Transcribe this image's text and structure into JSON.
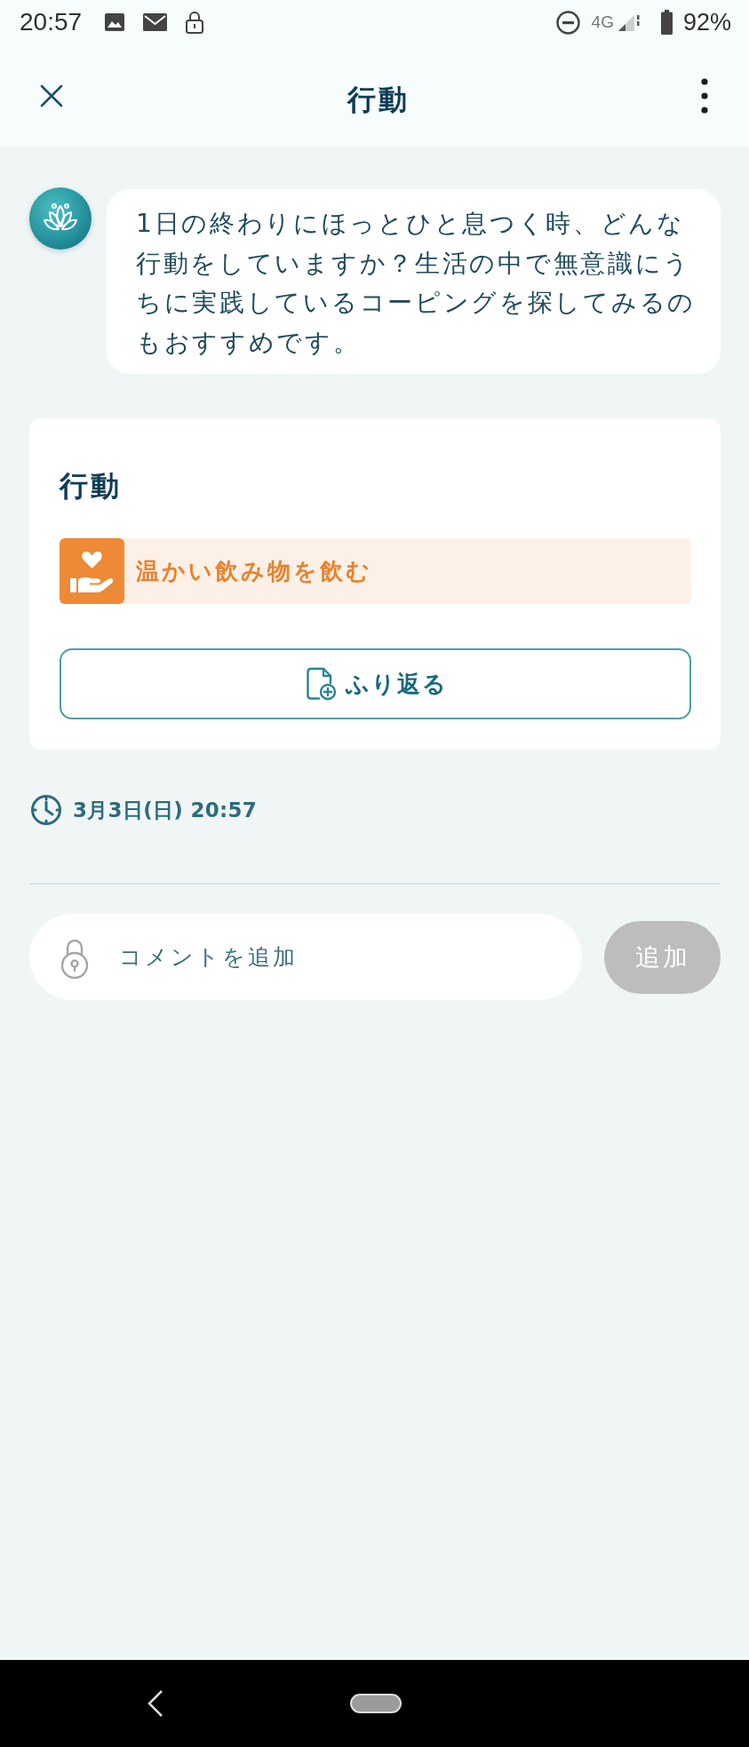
{
  "status_bar": {
    "time": "20:57",
    "network": "4G",
    "battery": "92%"
  },
  "header": {
    "title": "行動"
  },
  "message": {
    "text": "1日の終わりにほっとひと息つく時、どんな行動をしていますか？生活の中で無意識にうちに実践しているコーピングを探してみるのもおすすめです。"
  },
  "card": {
    "title": "行動",
    "actions": [
      {
        "label": "温かい飲み物を飲む"
      }
    ],
    "review_button": {
      "label": "ふり返る"
    }
  },
  "timestamp": "3月3日(日) 20:57",
  "comment": {
    "placeholder": "コメントを追加",
    "add_button": {
      "label": "追加",
      "disabled": true
    }
  }
}
